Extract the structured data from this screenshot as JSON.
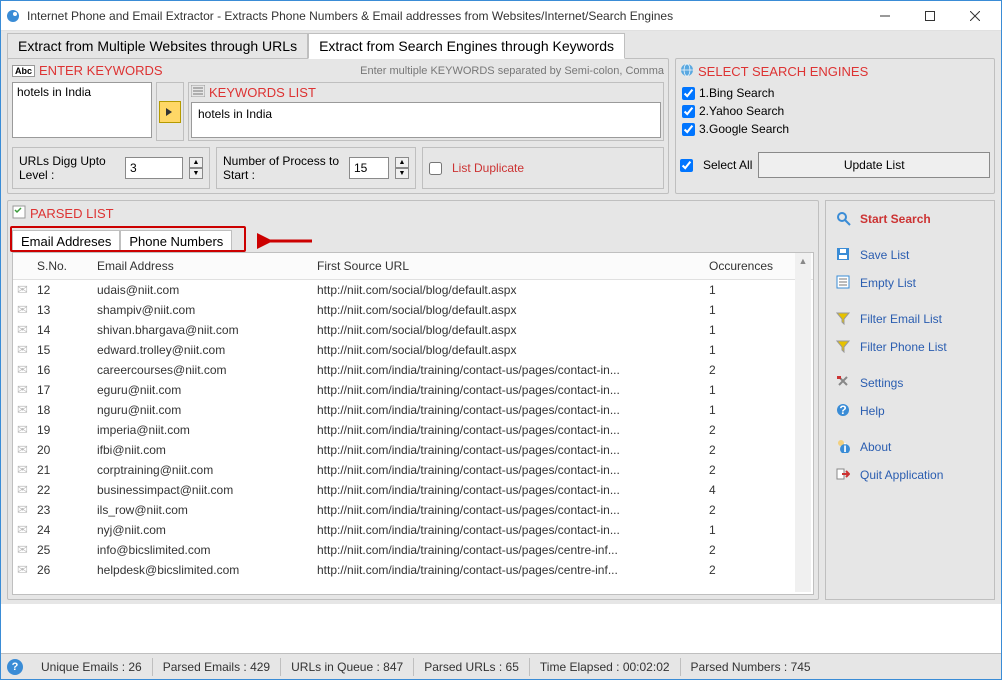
{
  "titlebar": {
    "title": "Internet Phone and Email Extractor - Extracts Phone Numbers & Email addresses from Websites/Internet/Search Engines"
  },
  "main_tabs": {
    "urls": "Extract from Multiple Websites through URLs",
    "keywords": "Extract from Search Engines through Keywords"
  },
  "enter_keywords": {
    "title": "ENTER KEYWORDS",
    "hint": "Enter multiple KEYWORDS separated by Semi-colon, Comma",
    "input_value": "hotels in India",
    "list_title": "KEYWORDS LIST",
    "list_value": "hotels in India"
  },
  "options": {
    "digg_label": "URLs Digg Upto Level :",
    "digg_value": "3",
    "process_label": "Number of Process to Start :",
    "process_value": "15",
    "list_duplicate": "List Duplicate"
  },
  "search_engines": {
    "title": "SELECT SEARCH ENGINES",
    "items": [
      "1.Bing Search",
      "2.Yahoo Search",
      "3.Google Search"
    ],
    "select_all": "Select All",
    "update": "Update List"
  },
  "parsed": {
    "title": "PARSED LIST",
    "tabs": {
      "email": "Email Addreses",
      "phone": "Phone Numbers"
    },
    "cols": {
      "sn": "S.No.",
      "email": "Email Address",
      "url": "First Source URL",
      "occ": "Occurences"
    },
    "rows": [
      {
        "sn": "12",
        "email": "udais@niit.com",
        "url": "http://niit.com/social/blog/default.aspx",
        "occ": "1"
      },
      {
        "sn": "13",
        "email": "shampiv@niit.com",
        "url": "http://niit.com/social/blog/default.aspx",
        "occ": "1"
      },
      {
        "sn": "14",
        "email": "shivan.bhargava@niit.com",
        "url": "http://niit.com/social/blog/default.aspx",
        "occ": "1"
      },
      {
        "sn": "15",
        "email": "edward.trolley@niit.com",
        "url": "http://niit.com/social/blog/default.aspx",
        "occ": "1"
      },
      {
        "sn": "16",
        "email": "careercourses@niit.com",
        "url": "http://niit.com/india/training/contact-us/pages/contact-in...",
        "occ": "2"
      },
      {
        "sn": "17",
        "email": "eguru@niit.com",
        "url": "http://niit.com/india/training/contact-us/pages/contact-in...",
        "occ": "1"
      },
      {
        "sn": "18",
        "email": "nguru@niit.com",
        "url": "http://niit.com/india/training/contact-us/pages/contact-in...",
        "occ": "1"
      },
      {
        "sn": "19",
        "email": "imperia@niit.com",
        "url": "http://niit.com/india/training/contact-us/pages/contact-in...",
        "occ": "2"
      },
      {
        "sn": "20",
        "email": "ifbi@niit.com",
        "url": "http://niit.com/india/training/contact-us/pages/contact-in...",
        "occ": "2"
      },
      {
        "sn": "21",
        "email": "corptraining@niit.com",
        "url": "http://niit.com/india/training/contact-us/pages/contact-in...",
        "occ": "2"
      },
      {
        "sn": "22",
        "email": "businessimpact@niit.com",
        "url": "http://niit.com/india/training/contact-us/pages/contact-in...",
        "occ": "4"
      },
      {
        "sn": "23",
        "email": "ils_row@niit.com",
        "url": "http://niit.com/india/training/contact-us/pages/contact-in...",
        "occ": "2"
      },
      {
        "sn": "24",
        "email": "nyj@niit.com",
        "url": "http://niit.com/india/training/contact-us/pages/contact-in...",
        "occ": "1"
      },
      {
        "sn": "25",
        "email": "info@bicslimited.com",
        "url": "http://niit.com/india/training/contact-us/pages/centre-inf...",
        "occ": "2"
      },
      {
        "sn": "26",
        "email": "helpdesk@bicslimited.com",
        "url": "http://niit.com/india/training/contact-us/pages/centre-inf...",
        "occ": "2"
      }
    ]
  },
  "sidebar": {
    "start": "Start Search",
    "save": "Save List",
    "empty": "Empty List",
    "filter_email": "Filter Email List",
    "filter_phone": "Filter Phone List",
    "settings": "Settings",
    "help": "Help",
    "about": "About",
    "quit": "Quit Application"
  },
  "status": {
    "unique_emails": "Unique Emails :  26",
    "parsed_emails": "Parsed Emails :  429",
    "urls_queue": "URLs in Queue :  847",
    "parsed_urls": "Parsed URLs :  65",
    "time": "Time Elapsed :  00:02:02",
    "parsed_numbers": "Parsed Numbers :  745"
  }
}
